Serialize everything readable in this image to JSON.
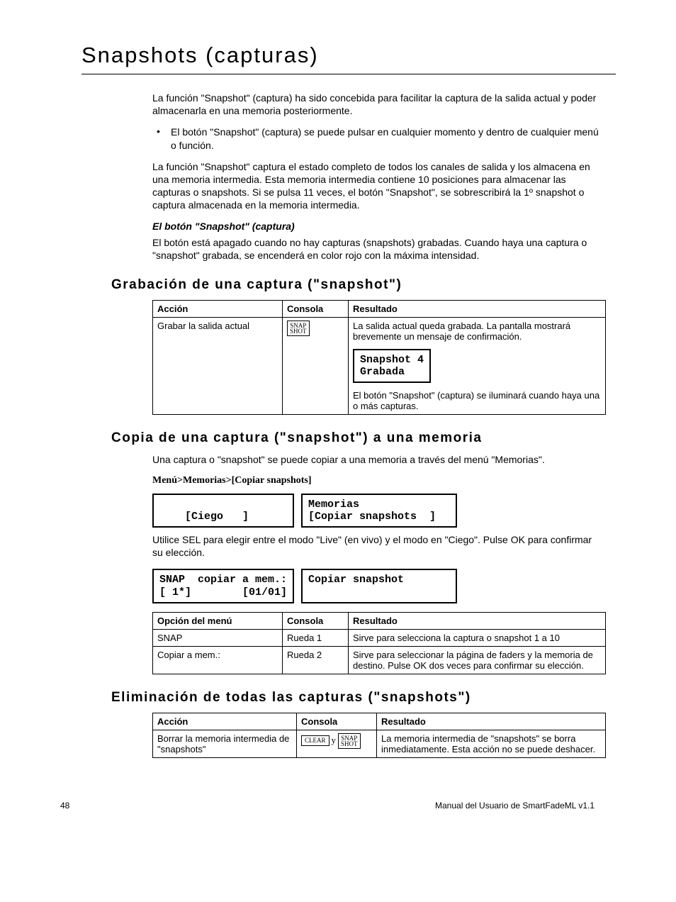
{
  "title": "Snapshots (capturas)",
  "intro_p1": "La función \"Snapshot\" (captura) ha sido concebida para facilitar la captura de la salida actual y poder almacenarla en una memoria posteriormente.",
  "intro_bullet": "El botón \"Snapshot\" (captura) se puede pulsar en cualquier momento y dentro de cualquier menú o función.",
  "intro_p2": "La función \"Snapshot\" captura el estado completo de todos los canales de salida y los almacena en una memoria intermedia. Esta memoria intermedia contiene 10 posiciones para almacenar las capturas o snapshots. Si se pulsa 11 veces, el botón \"Snapshot\", se sobrescribirá la 1º snapshot o captura almacenada en la memoria intermedia.",
  "sub_italic": "El botón \"Snapshot\" (captura)",
  "sub_italic_body": "El botón está apagado cuando no hay capturas (snapshots) grabadas. Cuando haya una captura o \"snapshot\" grabada, se encenderá en color rojo con la máxima intensidad.",
  "section1": {
    "title": "Grabación de una captura (\"snapshot\")",
    "headers": {
      "a": "Acción",
      "b": "Consola",
      "c": "Resultado"
    },
    "row": {
      "accion": "Grabar la salida actual",
      "key_l1": "SNAP",
      "key_l2": "SHOT",
      "result_before": "La salida actual queda grabada. La pantalla mostrará brevemente un mensaje de confirmación.",
      "lcd_l1": "Snapshot 4",
      "lcd_l2": "Grabada",
      "result_after": "El botón \"Snapshot\" (captura) se iluminará cuando haya una o más capturas."
    }
  },
  "section2": {
    "title": "Copia de una captura (\"snapshot\") a una memoria",
    "intro": "Una captura o \"snapshot\" se puede copiar a una memoria a través del menú \"Memorias\".",
    "menu_path": "Menú>Memorias>[Copiar snapshots]",
    "lcd1_l1": "",
    "lcd1_l2": "    [Ciego   ]",
    "lcd2_l1": "Memorias",
    "lcd2_l2": "[Copiar snapshots  ]",
    "after_lcd": "Utilice SEL para elegir entre el modo \"Live\" (en vivo) y el modo en \"Ciego\". Pulse OK para confirmar su elección.",
    "lcd3_l1": "SNAP  copiar a mem.:",
    "lcd3_l2": "[ 1*]        [01/01]",
    "lcd4_l1": "Copiar snapshot",
    "lcd4_l2": " ",
    "headers": {
      "a": "Opción del menú",
      "b": "Consola",
      "c": "Resultado"
    },
    "rows": [
      {
        "a": "SNAP",
        "b": "Rueda 1",
        "c": "Sirve para selecciona la captura o snapshot 1 a 10"
      },
      {
        "a": "Copiar a mem.:",
        "b": "Rueda 2",
        "c": "Sirve para seleccionar la página de faders y la memoria de destino. Pulse OK dos veces para confirmar su elección."
      }
    ]
  },
  "section3": {
    "title": "Eliminación de todas las capturas (\"snapshots\")",
    "headers": {
      "a": "Acción",
      "b": "Consola",
      "c": "Resultado"
    },
    "row": {
      "accion": "Borrar la memoria intermedia de \"snapshots\"",
      "key1": "CLEAR",
      "sep": "y",
      "key2_l1": "SNAP",
      "key2_l2": "SHOT",
      "result": "La memoria intermedia de \"snapshots\" se borra inmediatamente. Esta acción no se puede deshacer."
    }
  },
  "footer": {
    "page": "48",
    "doc": "Manual del Usuario de SmartFadeML v1.1"
  }
}
